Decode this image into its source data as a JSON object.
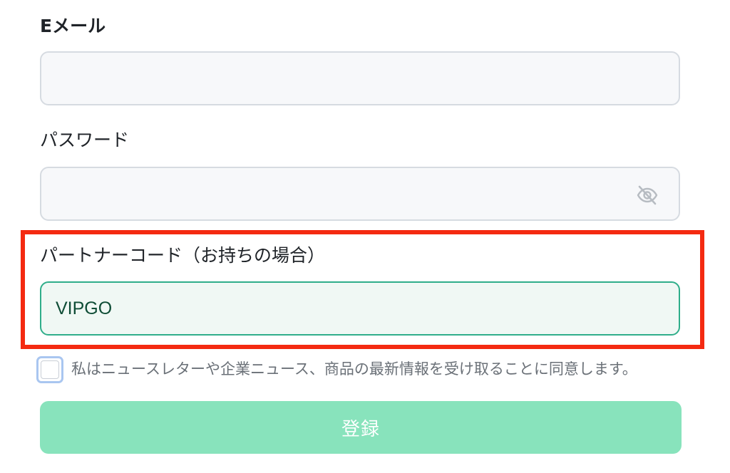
{
  "form": {
    "email": {
      "label": "Eメール",
      "value": ""
    },
    "password": {
      "label": "パスワード",
      "value": "",
      "toggle_icon": "eye-off-icon"
    },
    "partner_code": {
      "label": "パートナーコード（お持ちの場合）",
      "value": "VIPGO"
    },
    "newsletter": {
      "label": "私はニュースレターや企業ニュース、商品の最新情報を受け取ることに同意します。",
      "checked": false
    },
    "submit_label": "登録"
  },
  "colors": {
    "highlight": "#f42a11",
    "submit_bg": "#88e3bc",
    "active_border": "#2fae8a"
  }
}
